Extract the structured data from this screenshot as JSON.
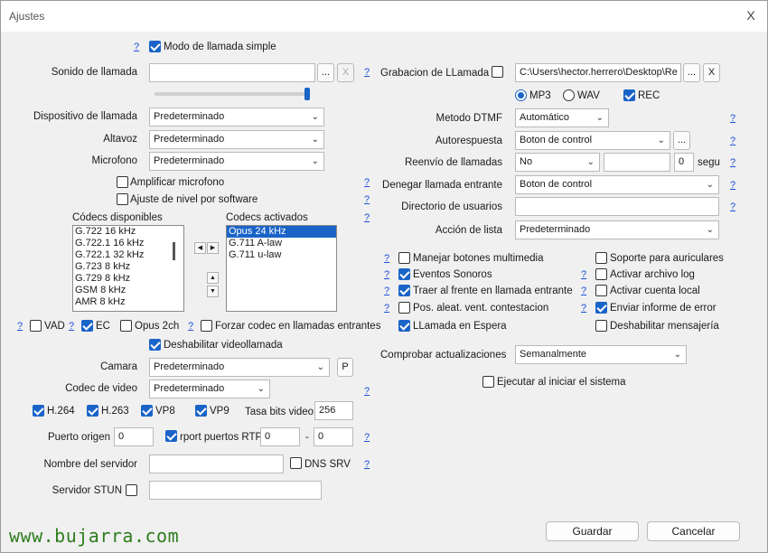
{
  "window": {
    "title": "Ajustes",
    "close": "X"
  },
  "help": "?",
  "simple_mode": {
    "label": "Modo de llamada simple",
    "checked": true
  },
  "ring": {
    "label": "Sonido de llamada",
    "value": "",
    "browse": "...",
    "clear": "X",
    "volume": 1.0
  },
  "device": {
    "label": "Dispositivo de llamada",
    "value": "Predeterminado"
  },
  "speaker": {
    "label": "Altavoz",
    "value": "Predeterminado"
  },
  "mic": {
    "label": "Microfono",
    "value": "Predeterminado"
  },
  "amplify_mic": {
    "label": "Amplificar microfono",
    "checked": false
  },
  "soft_level": {
    "label": "Ajuste de nivel por software",
    "checked": false
  },
  "codecs": {
    "available_label": "Códecs disponibles",
    "available": [
      "G.722 16 kHz",
      "G.722.1 16 kHz",
      "G.722.1 32 kHz",
      "G.723 8 kHz",
      "G.729 8 kHz",
      "GSM 8 kHz",
      "AMR 8 kHz"
    ],
    "active_label": "Codecs activados",
    "active": [
      "Opus 24 kHz",
      "G.711 A-law",
      "G.711 u-law"
    ]
  },
  "vad": {
    "label": "VAD",
    "checked": false
  },
  "ec": {
    "label": "EC",
    "checked": true
  },
  "opus2ch": {
    "label": "Opus 2ch",
    "checked": false
  },
  "force_codec": {
    "label": "Forzar codec en llamadas entrantes",
    "checked": false
  },
  "disable_video": {
    "label": "Deshabilitar videollamada",
    "checked": true
  },
  "camera": {
    "label": "Camara",
    "value": "Predeterminado",
    "btn": "P"
  },
  "video_codec": {
    "label": "Codec de video",
    "value": "Predeterminado"
  },
  "video_codecs": [
    {
      "label": "H.264",
      "checked": true
    },
    {
      "label": "H.263",
      "checked": true
    },
    {
      "label": "VP8",
      "checked": true
    },
    {
      "label": "VP9",
      "checked": true
    }
  ],
  "bitrate": {
    "label": "Tasa bits video",
    "value": "256"
  },
  "src_port": {
    "label": "Puerto origen",
    "value": "0"
  },
  "rtp_ports": {
    "label": "rport puertos RTP",
    "checked": true,
    "from": "0",
    "sep": "-",
    "to": "0"
  },
  "server_name": {
    "label": "Nombre del servidor",
    "value": ""
  },
  "dns_srv": {
    "label": "DNS SRV",
    "checked": false
  },
  "stun": {
    "label": "Servidor STUN",
    "checked": false,
    "value": ""
  },
  "recording": {
    "label": "Grabacion de LLamada",
    "checked": false,
    "path": "C:\\Users\\hector.herrero\\Desktop\\Re",
    "browse": "...",
    "clear": "X",
    "mp3": "MP3",
    "wav": "WAV",
    "format": "mp3",
    "rec": "REC",
    "rec_checked": true
  },
  "dtmf": {
    "label": "Metodo DTMF",
    "value": "Automático"
  },
  "autoanswer": {
    "label": "Autorespuesta",
    "value": "Boton de control",
    "btn": "..."
  },
  "forward": {
    "label": "Reenvío de llamadas",
    "value": "No",
    "number": "",
    "seconds": "0",
    "sec_label": "segu"
  },
  "deny": {
    "label": "Denegar llamada entrante",
    "value": "Boton de control"
  },
  "directory": {
    "label": "Directorio de usuarios",
    "value": ""
  },
  "list_action": {
    "label": "Acción de lista",
    "value": "Predeterminado"
  },
  "options_left": [
    {
      "label": "Manejar botones multimedia",
      "checked": false
    },
    {
      "label": "Eventos Sonoros",
      "checked": true
    },
    {
      "label": "Traer al frente en llamada entrante",
      "checked": true
    },
    {
      "label": "Pos. aleat. vent. contestacion",
      "checked": false
    },
    {
      "label": "LLamada en Espera",
      "checked": true
    }
  ],
  "options_right": [
    {
      "label": "Soporte para auriculares",
      "checked": false
    },
    {
      "label": "Activar archivo log",
      "checked": false
    },
    {
      "label": "Activar cuenta local",
      "checked": false
    },
    {
      "label": "Enviar informe de error",
      "checked": true
    },
    {
      "label": "Deshabilitar mensajería",
      "checked": false
    }
  ],
  "updates": {
    "label": "Comprobar actualizaciones",
    "value": "Semanalmente"
  },
  "startup": {
    "label": "Ejecutar al iniciar el sistema",
    "checked": false
  },
  "buttons": {
    "save": "Guardar",
    "cancel": "Cancelar"
  },
  "watermark": "www.bujarra.com",
  "accent": "#1a64c8"
}
